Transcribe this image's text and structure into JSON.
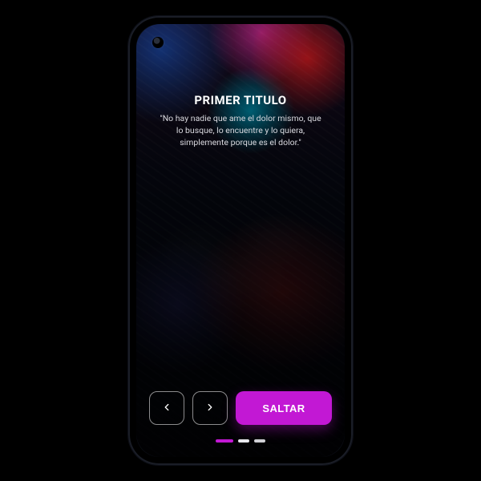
{
  "colors": {
    "accent": "#c218d4",
    "text": "#ffffff",
    "muted": "#d9d9df"
  },
  "onboarding": {
    "title": "PRIMER TITULO",
    "subtitle": "\"No hay nadie que ame el dolor mismo, que lo busque, lo encuentre y lo quiera, simplemente porque es el dolor.\"",
    "skip_label": "SALTAR",
    "page_index": 0,
    "page_count": 3
  },
  "icons": {
    "prev": "chevron-left",
    "next": "chevron-right"
  }
}
